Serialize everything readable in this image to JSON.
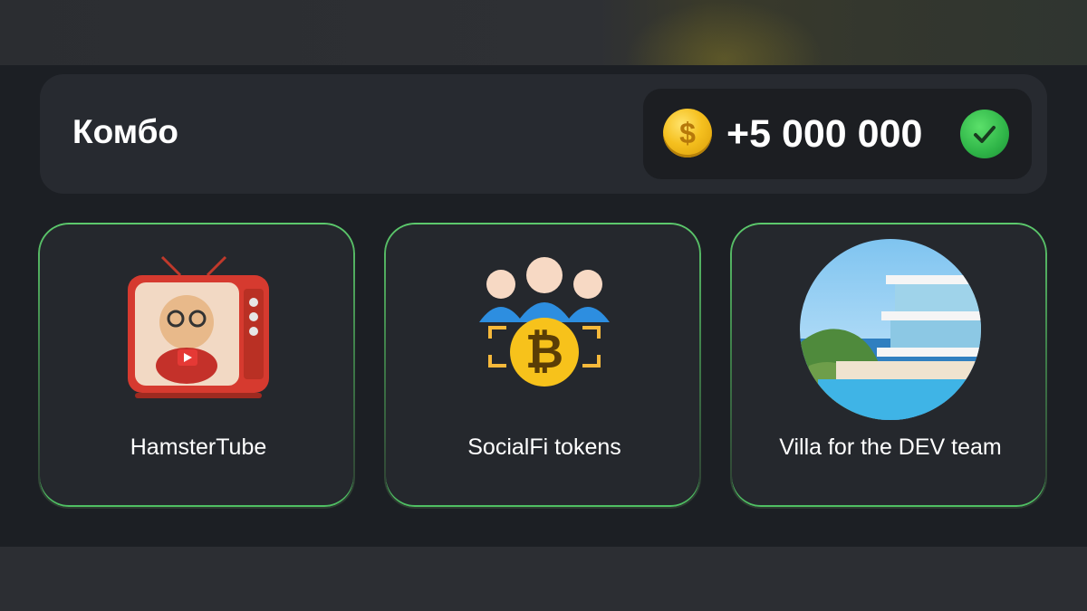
{
  "combo": {
    "title": "Комбо",
    "reward_amount": "+5 000 000",
    "coin_icon": "gold-dollar-coin-icon",
    "status_icon": "green-checkmark-icon",
    "coin_symbol": "$"
  },
  "cards": [
    {
      "label": "HamsterTube",
      "image": "hamster-tv-image"
    },
    {
      "label": "SocialFi tokens",
      "image": "community-bitcoin-icon",
      "symbol": "₿"
    },
    {
      "label": "Villa for the DEV team",
      "image": "seaside-villa-image"
    }
  ],
  "colors": {
    "background": "#1c1f24",
    "panel": "#272a30",
    "card_border": "#5cc96c",
    "coin": "#f5c01f",
    "check": "#2fb548"
  }
}
